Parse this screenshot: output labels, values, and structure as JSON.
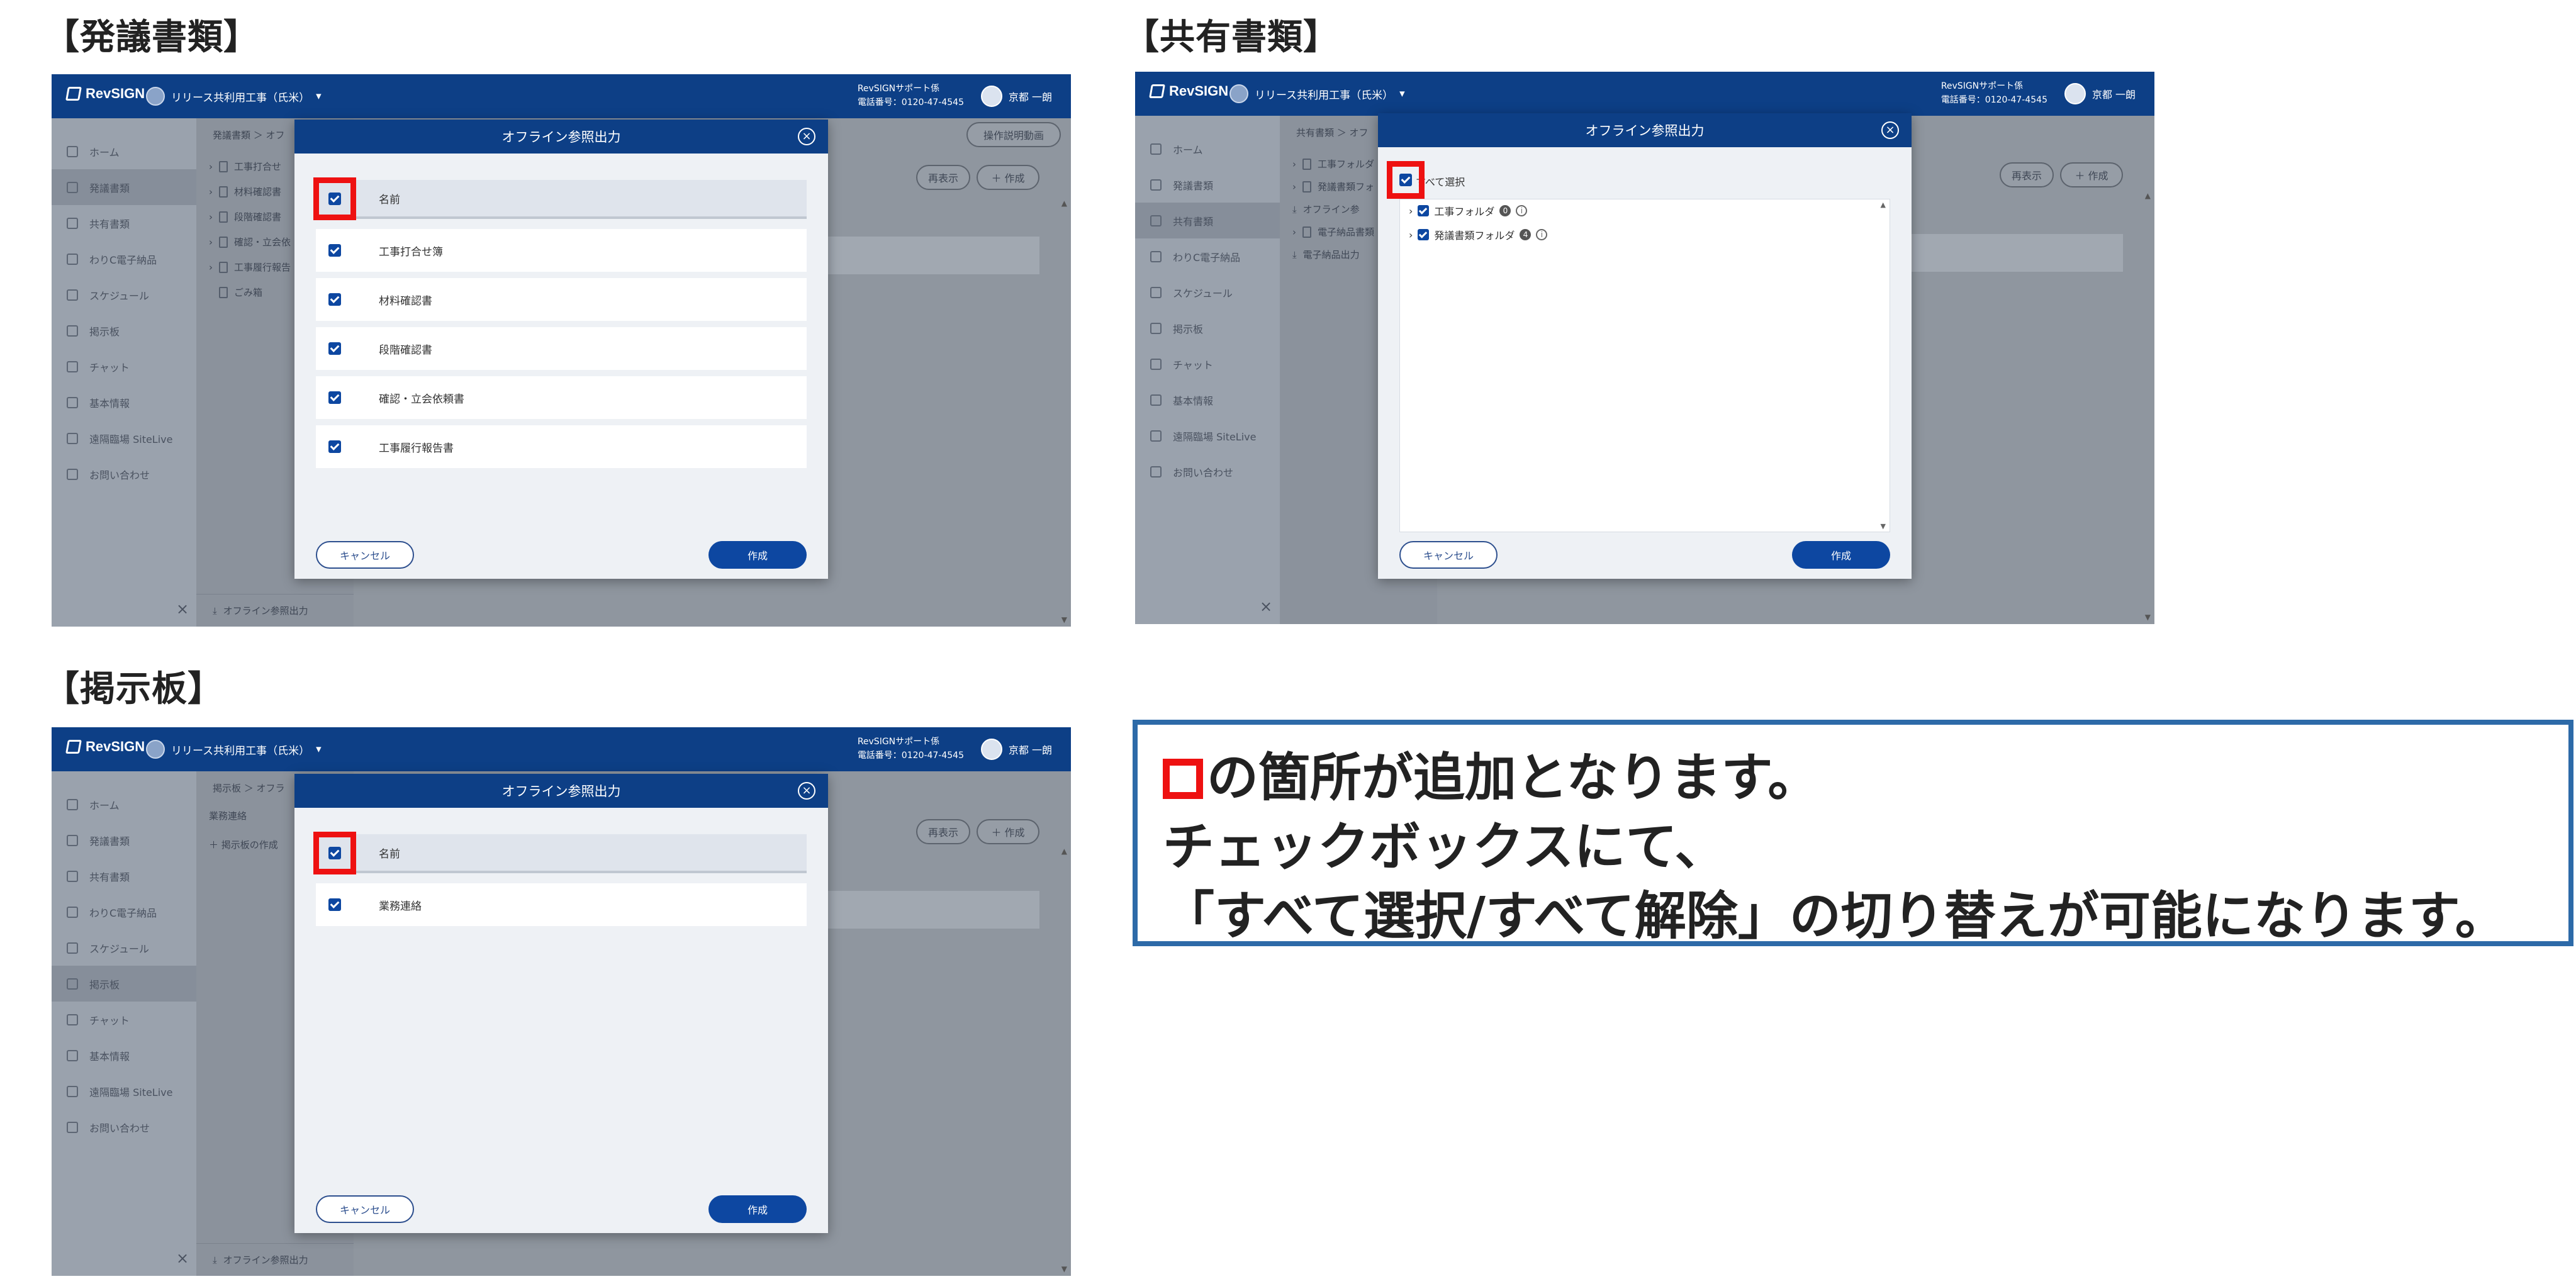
{
  "sections": {
    "hatsugi": "【発議書類】",
    "kyoyu": "【共有書類】",
    "keiji": "【掲示板】"
  },
  "app": {
    "logo": "RevSIGN",
    "project": "リリース共利用工事（氏米）",
    "support_line1": "RevSIGNサポート係",
    "support_line2": "電話番号：0120-47-4545",
    "user": "京都 一朗"
  },
  "sidebar": {
    "items": [
      {
        "label": "ホーム",
        "icon": "home-icon"
      },
      {
        "label": "発議書類",
        "icon": "document-icon"
      },
      {
        "label": "共有書類",
        "icon": "share-icon"
      },
      {
        "label": "わりC電子納品",
        "icon": "delivery-icon"
      },
      {
        "label": "スケジュール",
        "icon": "calendar-icon"
      },
      {
        "label": "掲示板",
        "icon": "board-icon"
      },
      {
        "label": "チャット",
        "icon": "chat-icon"
      },
      {
        "label": "基本情報",
        "icon": "info-icon"
      },
      {
        "label": "遠隔臨場 SiteLive",
        "icon": "camera-icon"
      },
      {
        "label": "お問い合わせ",
        "icon": "help-icon"
      }
    ]
  },
  "panel1": {
    "crumb": "発議書類 ＞ オフ",
    "tree": [
      "工事打合せ",
      "材料確認書",
      "段階確認書",
      "確認・立会依",
      "工事履行報告"
    ],
    "trash": "ごみ箱",
    "footer": "オフライン参照出力",
    "help_button": "操作説明動画",
    "refresh": "再表示",
    "create": "＋ 作成",
    "dialog": {
      "title": "オフライン参照出力",
      "header": "名前",
      "rows": [
        "工事打合せ簿",
        "材料確認書",
        "段階確認書",
        "確認・立会依頼書",
        "工事履行報告書"
      ],
      "cancel": "キャンセル",
      "submit": "作成"
    }
  },
  "panel2": {
    "crumb": "共有書類 ＞ オフ",
    "tree": [
      "工事フォルダ",
      "発議書類フォ",
      "オフライン参",
      "電子納品書類",
      "電子納品出力"
    ],
    "refresh": "再表示",
    "create": "＋ 作成",
    "dialog": {
      "title": "オフライン参照出力",
      "select_all": "すべて選択",
      "folders": [
        {
          "label": "工事フォルダ",
          "count": "0"
        },
        {
          "label": "発議書類フォルダ",
          "count": "4"
        }
      ],
      "cancel": "キャンセル",
      "submit": "作成"
    }
  },
  "panel3": {
    "crumb": "掲示板 ＞ オフラ",
    "tree_title": "業務連絡",
    "tree_action": "＋ 掲示板の作成",
    "footer": "オフライン参照出力",
    "refresh": "再表示",
    "create": "＋ 作成",
    "dialog": {
      "title": "オフライン参照出力",
      "header": "名前",
      "rows": [
        "業務連絡"
      ],
      "cancel": "キャンセル",
      "submit": "作成"
    }
  },
  "note": {
    "line1": "の箇所が追加となります。",
    "line2": "チェックボックスにて、",
    "line3": "「すべて選択/すべて解除」の切り替えが可能になります。"
  },
  "colors": {
    "brand_blue": "#0d3f86",
    "button_blue": "#0d47a1",
    "highlight_red": "#ee1111",
    "note_border": "#2d6aa8"
  }
}
